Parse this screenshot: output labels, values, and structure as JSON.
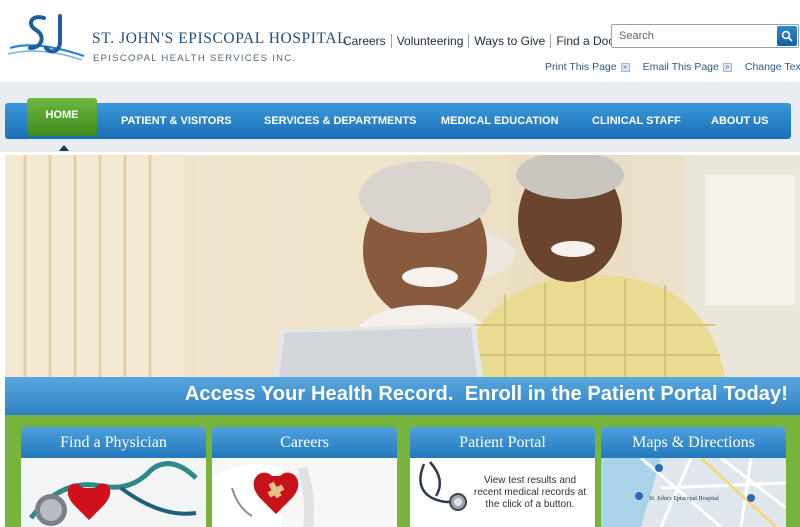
{
  "brand": {
    "name": "St. John's Episcopal Hospital",
    "subtitle": "Episcopal Health Services Inc."
  },
  "top_links": [
    "Careers",
    "Volunteering",
    "Ways to Give",
    "Find a Doctor"
  ],
  "search": {
    "placeholder": "Search"
  },
  "utility_links": [
    "Print This Page",
    "Email This Page",
    "Change Text Size"
  ],
  "nav": {
    "home": "HOME",
    "items": [
      "PATIENT & VISITORS",
      "SERVICES & DEPARTMENTS",
      "MEDICAL EDUCATION",
      "CLINICAL STAFF",
      "ABOUT US"
    ]
  },
  "banner": {
    "text": "Access Your Health Record.  Enroll in the Patient Portal Today!"
  },
  "cards": [
    {
      "title": "Find a Physician"
    },
    {
      "title": "Careers"
    },
    {
      "title": "Patient Portal",
      "description": "View test results and recent medical records at the click of a button."
    },
    {
      "title": "Maps & Directions",
      "map_label": "St. John's Episcopal Hospital"
    }
  ],
  "colors": {
    "brand_blue": "#1d4f7e",
    "nav_blue": "#2a83c8",
    "home_green": "#5aa530",
    "promo_green": "#77b43c"
  }
}
